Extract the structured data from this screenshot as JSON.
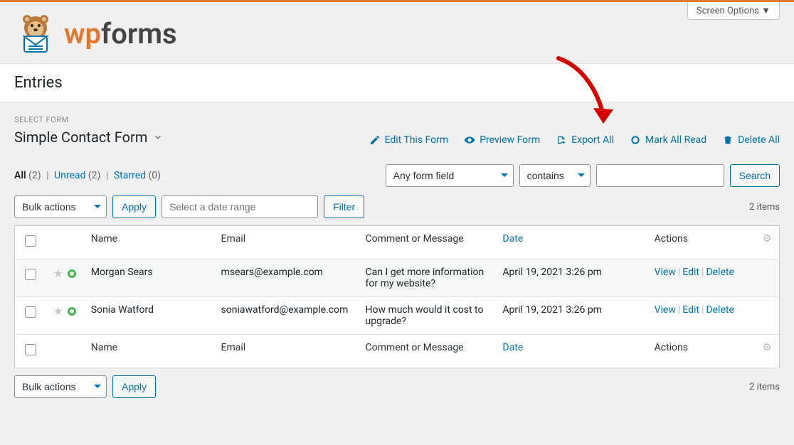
{
  "brand": {
    "wp": "wp",
    "forms": "forms"
  },
  "screen_options": "Screen Options",
  "page_title": "Entries",
  "select_form_label": "SELECT FORM",
  "form_name": "Simple Contact Form",
  "actions": {
    "edit": "Edit This Form",
    "preview": "Preview Form",
    "export": "Export All",
    "mark_read": "Mark All Read",
    "delete_all": "Delete All"
  },
  "status": {
    "all_label": "All",
    "all_count": "(2)",
    "unread_label": "Unread",
    "unread_count": "(2)",
    "starred_label": "Starred",
    "starred_count": "(0)"
  },
  "search": {
    "field": "Any form field",
    "op": "contains",
    "value": "",
    "button": "Search"
  },
  "bulk": {
    "label": "Bulk actions",
    "apply": "Apply",
    "date_placeholder": "Select a date range",
    "filter": "Filter"
  },
  "items_label": "2 items",
  "columns": {
    "name": "Name",
    "email": "Email",
    "message": "Comment or Message",
    "date": "Date",
    "actions": "Actions"
  },
  "row_actions": {
    "view": "View",
    "edit": "Edit",
    "delete": "Delete"
  },
  "rows": [
    {
      "name": "Morgan Sears",
      "email": "msears@example.com",
      "message": "Can I get more information for my website?",
      "date": "April 19, 2021 3:26 pm"
    },
    {
      "name": "Sonia Watford",
      "email": "soniawatford@example.com",
      "message": "How much would it cost to upgrade?",
      "date": "April 19, 2021 3:26 pm"
    }
  ]
}
